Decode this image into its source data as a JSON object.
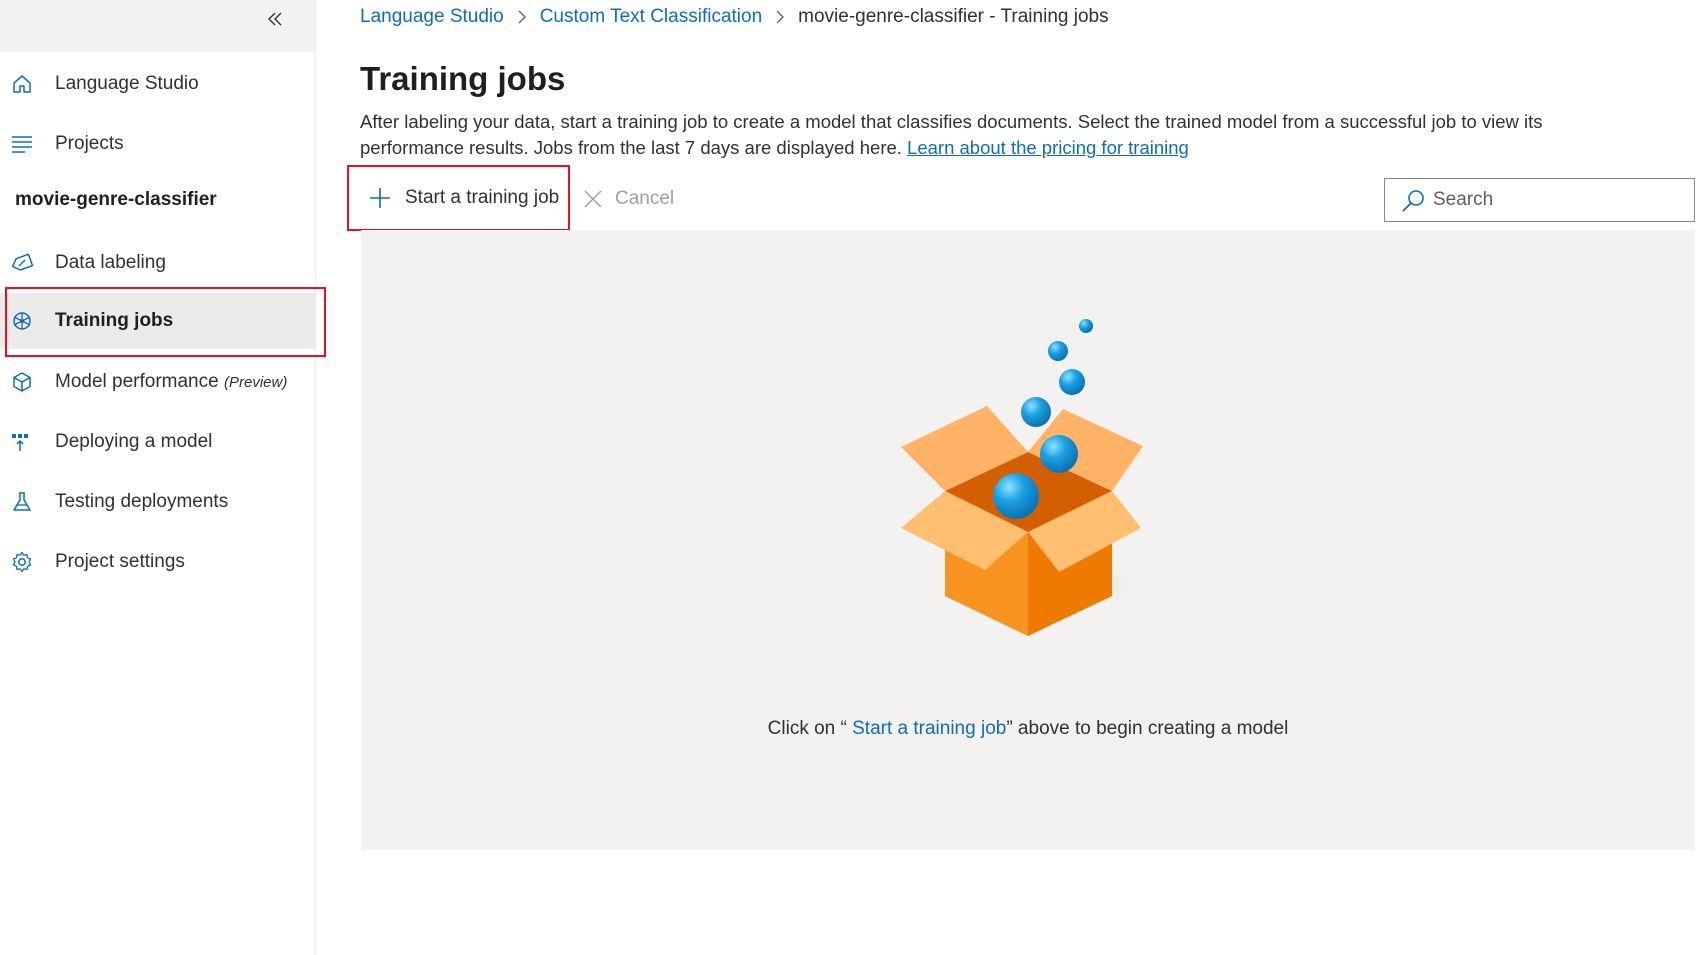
{
  "sidebar": {
    "collapse_icon": "double-chevron-left-icon",
    "items_top": [
      {
        "label": "Language Studio",
        "icon": "home-icon"
      },
      {
        "label": "Projects",
        "icon": "list-icon"
      }
    ],
    "project_name": "movie-genre-classifier",
    "items_project": [
      {
        "label": "Data labeling",
        "icon": "tag-icon"
      },
      {
        "label": "Training jobs",
        "icon": "brain-circuit-icon",
        "active": true
      },
      {
        "label": "Model performance",
        "suffix": "(Preview)",
        "icon": "cube-icon"
      },
      {
        "label": "Deploying a model",
        "icon": "deploy-icon"
      },
      {
        "label": "Testing deployments",
        "icon": "flask-icon"
      },
      {
        "label": "Project settings",
        "icon": "gear-icon"
      }
    ]
  },
  "breadcrumb": {
    "items": [
      "Language Studio",
      "Custom Text Classification"
    ],
    "current": "movie-genre-classifier - Training jobs"
  },
  "page": {
    "title": "Training jobs",
    "description": "After labeling your data, start a training job to create a model that classifies documents. Select the trained model from a successful job to view its performance results. Jobs from the last 7 days are displayed here.",
    "pricing_link": "Learn about the pricing for training"
  },
  "toolbar": {
    "start_label": "Start a training job",
    "cancel_label": "Cancel",
    "search_placeholder": "Search"
  },
  "empty_state": {
    "prefix": "Click on “ ",
    "link": "Start a training job",
    "suffix": "” above to begin creating a model",
    "illustration": "open-box-with-bubbles-illustration"
  },
  "colors": {
    "accent": "#0f6cbd",
    "highlight": "#e81123",
    "box_orange": "#f7931e",
    "bubble_blue": "#1ba1e2"
  }
}
